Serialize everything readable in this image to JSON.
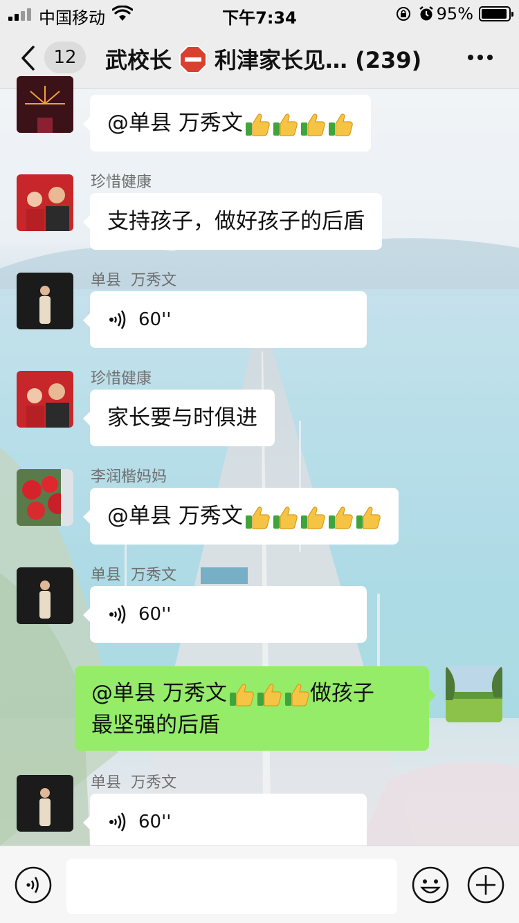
{
  "status_bar": {
    "carrier": "中国移动",
    "time": "下午7:34",
    "battery": "95%",
    "battery_level": 0.95
  },
  "header": {
    "unread_count": "12",
    "title_part1": "武校长",
    "title_part2": "利津家长见… (239)"
  },
  "messages": [
    {
      "type": "text",
      "sender": "",
      "text": "@单县  万秀文",
      "thumbs": 4
    },
    {
      "type": "text",
      "sender": "珍惜健康",
      "text": "支持孩子，做好孩子的后盾"
    },
    {
      "type": "voice",
      "sender": "单县  万秀文",
      "duration": "60''"
    },
    {
      "type": "text",
      "sender": "珍惜健康",
      "text": "家长要与时俱进"
    },
    {
      "type": "text",
      "sender": "李润楷妈妈",
      "text": "@单县  万秀文",
      "thumbs": 5
    },
    {
      "type": "voice",
      "sender": "单县  万秀文",
      "duration": "60''"
    },
    {
      "type": "mine",
      "line1": "@单县  万秀文",
      "line1_suffix": "做孩子",
      "line2": "最坚强的后盾",
      "thumbs": 3
    },
    {
      "type": "voice",
      "sender": "单县  万秀文",
      "duration": "60''"
    }
  ],
  "colors": {
    "mine_bubble": "#95ec69",
    "bubble": "#ffffff",
    "bar": "#ededed"
  },
  "icons": [
    "back-chevron-icon",
    "stop-sign-icon",
    "more-icon",
    "voice-icon",
    "thumbs-up-icon",
    "voice-input-icon",
    "emoji-icon",
    "plus-icon"
  ]
}
